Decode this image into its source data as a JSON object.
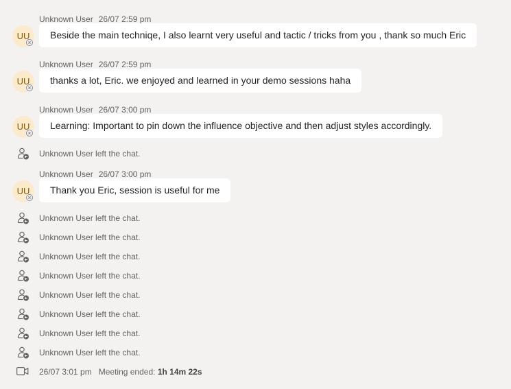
{
  "messages": [
    {
      "sender": "Unknown User",
      "time": "26/07 2:59 pm",
      "initials": "UU",
      "text": "Beside the main techniqe, I also learnt very useful and tactic / tricks from you , thank so much Eric"
    },
    {
      "sender": "Unknown User",
      "time": "26/07 2:59 pm",
      "initials": "UU",
      "text": "thanks a lot, Eric. we enjoyed and learned in your demo sessions haha"
    },
    {
      "sender": "Unknown User",
      "time": "26/07 3:00 pm",
      "initials": "UU",
      "text": "Learning:  Important to pin down the influence objective and then adjust styles accordingly."
    },
    {
      "sender": "Unknown User",
      "time": "26/07 3:00 pm",
      "initials": "UU",
      "text": "Thank you Eric, session is useful for me"
    }
  ],
  "events": {
    "left_chat": "Unknown User left the chat."
  },
  "meeting_end": {
    "time": "26/07 3:01 pm",
    "label": "Meeting ended:",
    "duration": "1h 14m 22s"
  },
  "colors": {
    "background": "#f3f2f1",
    "bubble": "#ffffff",
    "avatar_bg": "#fbeacb",
    "avatar_text": "#8a5a00",
    "meta_text": "#616161"
  },
  "icons": {
    "presence": "presence-offline-icon",
    "left_chat": "person-left-icon",
    "meeting_end": "video-camera-icon"
  }
}
